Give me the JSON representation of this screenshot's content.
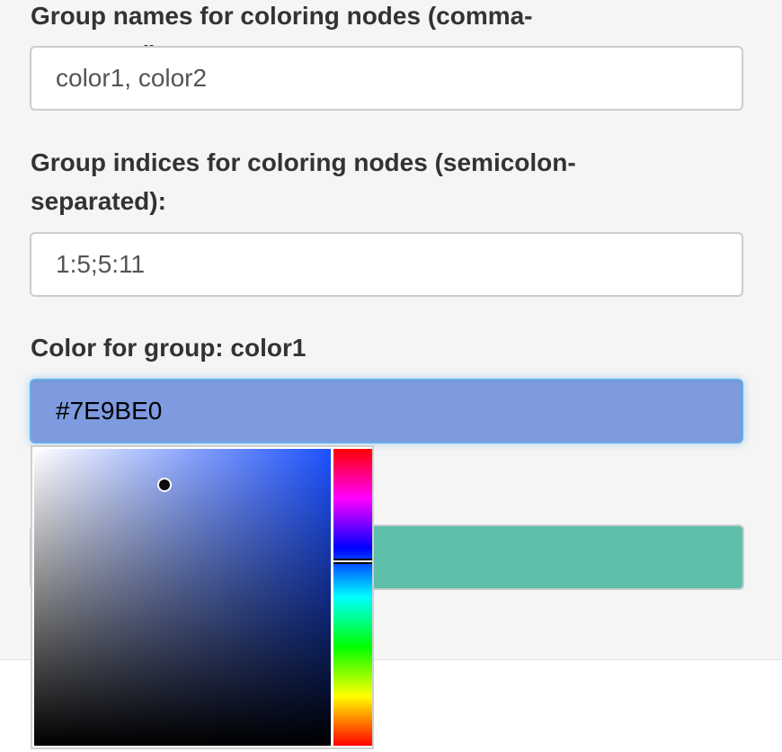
{
  "form": {
    "group_names": {
      "label": "Group names for coloring nodes (comma-separated):",
      "value": "color1, color2"
    },
    "group_indices": {
      "label": "Group indices for coloring nodes (semicolon-separated):",
      "value": "1:5;5:11"
    },
    "color_group1": {
      "label": "Color for group: color1",
      "value": "#7E9BE0"
    },
    "color_group2": {
      "value": "#5EBFAA"
    }
  },
  "color_picker": {
    "hue_color": "#1E52FF",
    "saturation_value": [
      0.44,
      0.88
    ],
    "hue_level": 0.38
  }
}
